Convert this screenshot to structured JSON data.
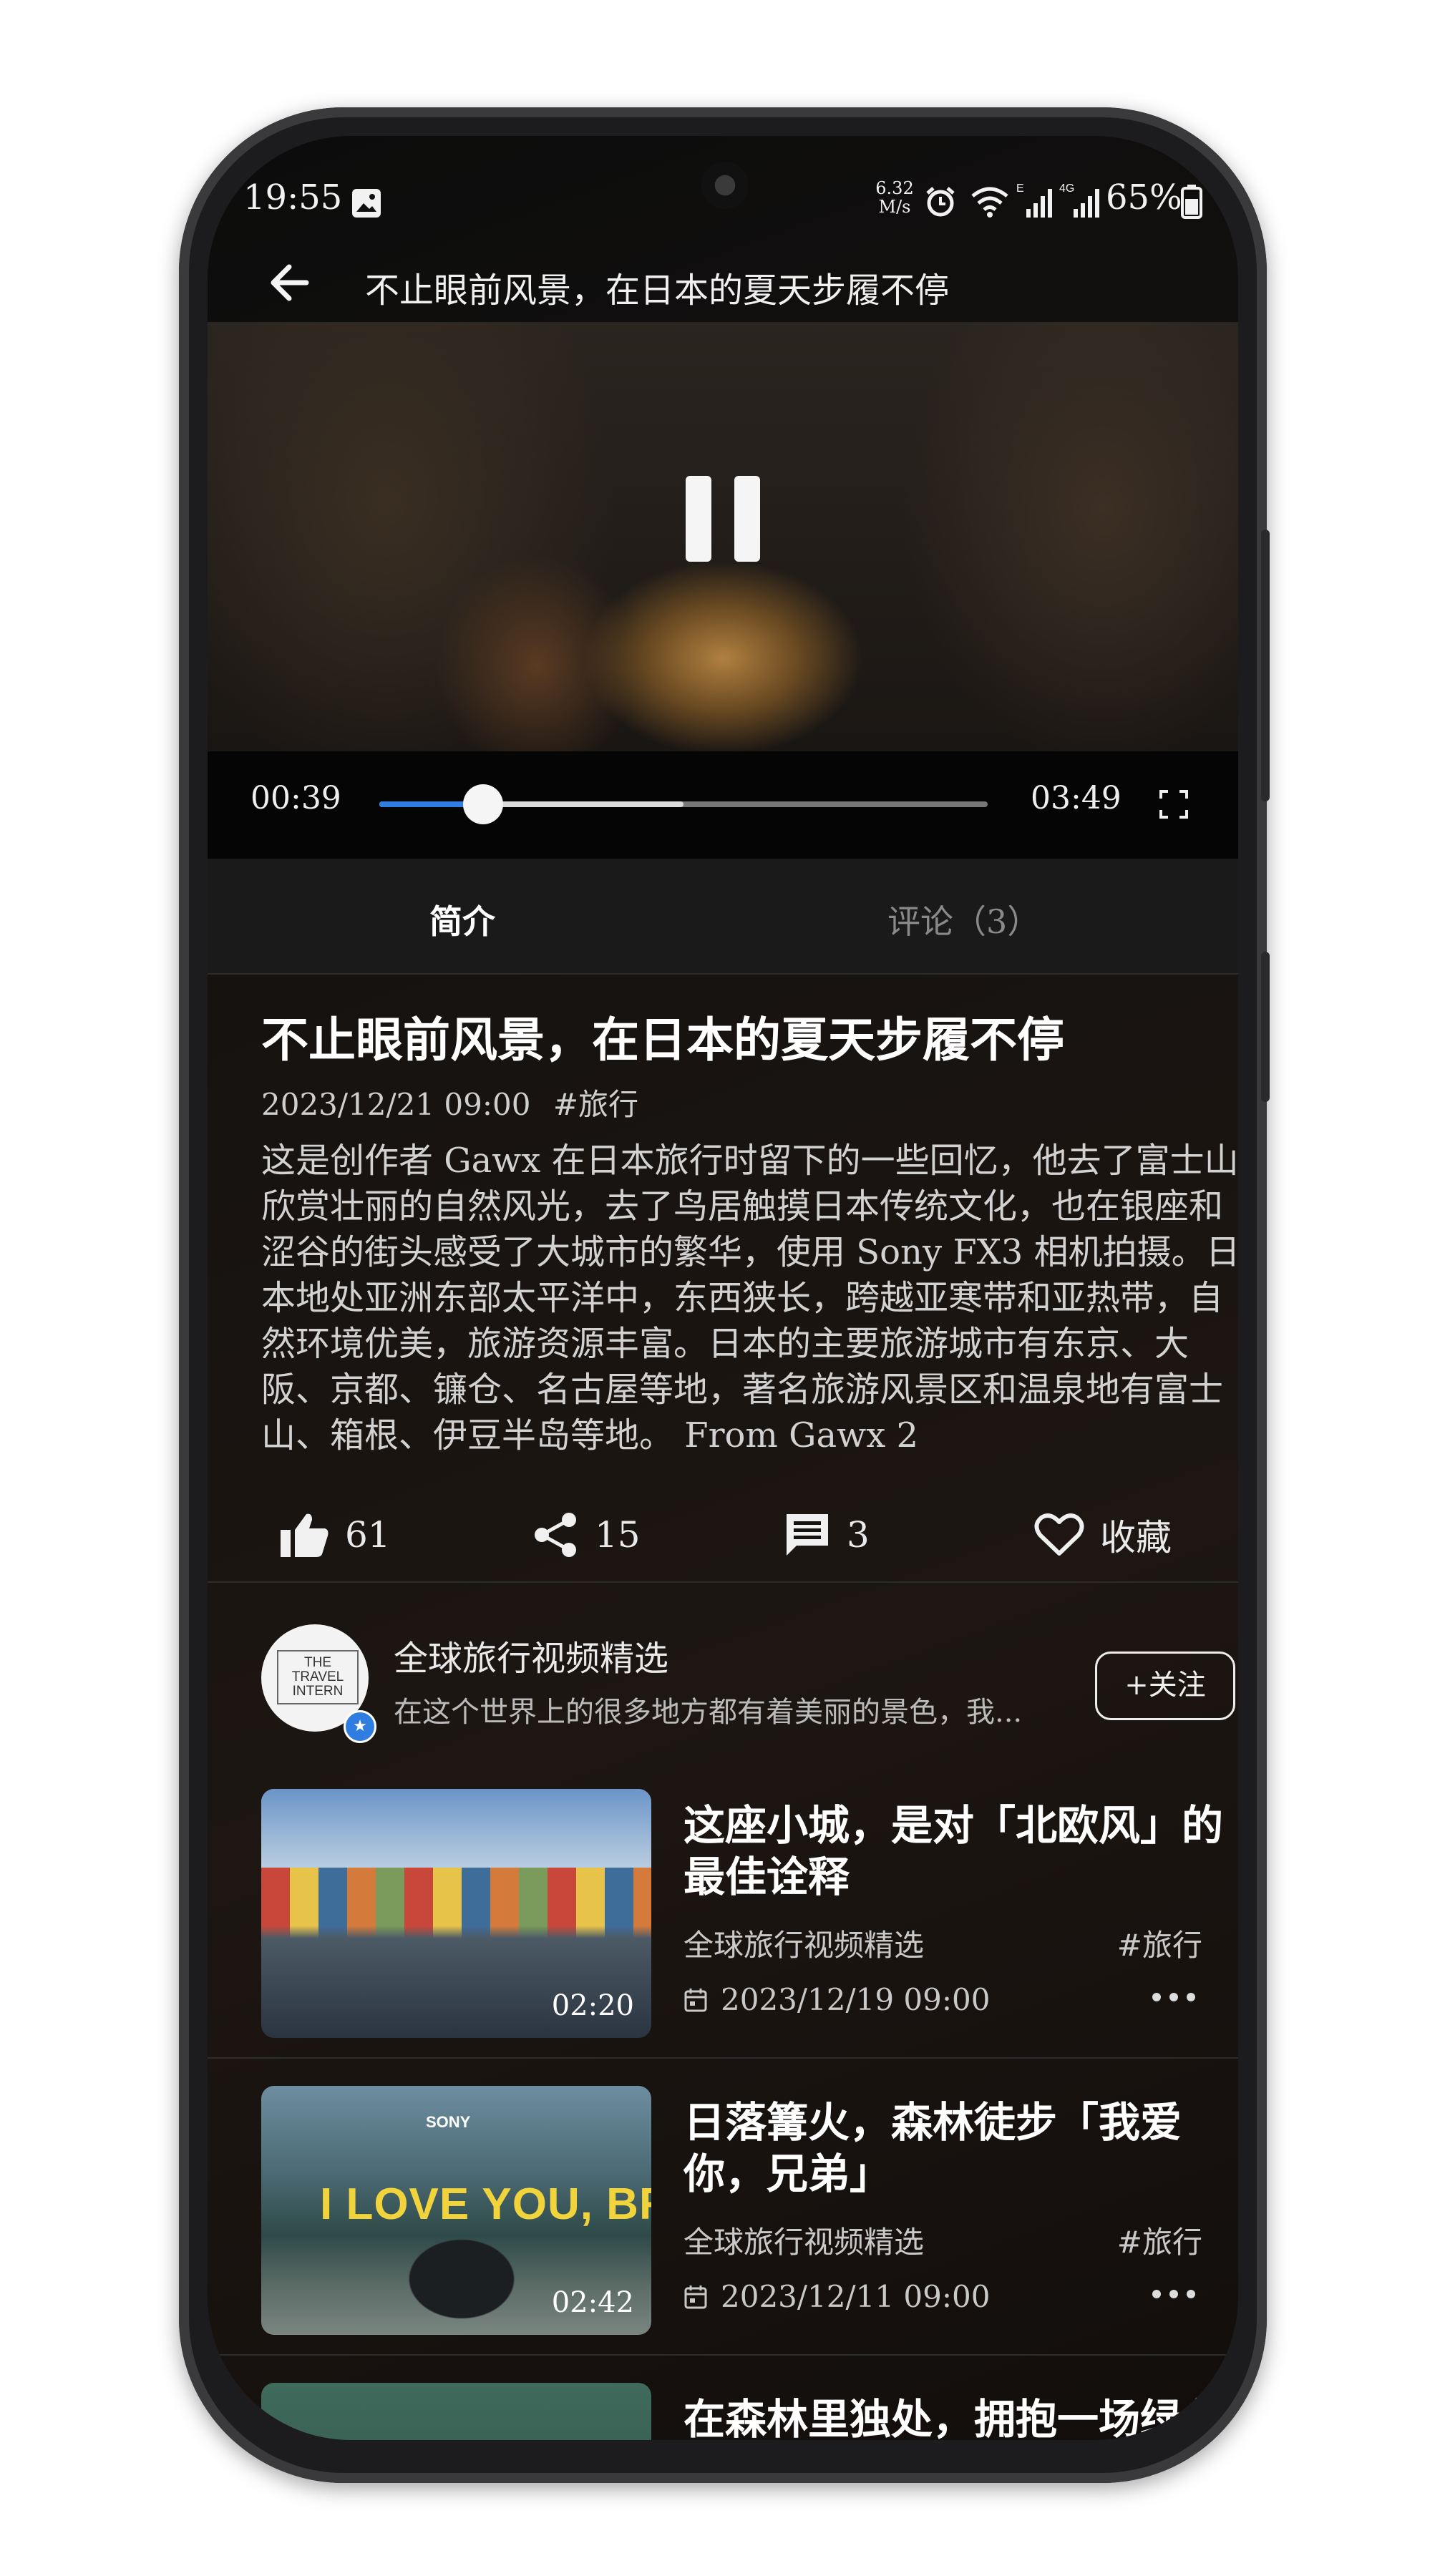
{
  "status_bar": {
    "time": "19:55",
    "net_speed": "6.32 M/s",
    "battery": "65%"
  },
  "header": {
    "title": "不止眼前风景，在日本的夏天步履不停"
  },
  "player": {
    "current_time": "00:39",
    "total_time": "03:49",
    "progress_fraction": 0.17,
    "buffered_fraction": 0.5
  },
  "tabs": [
    {
      "label": "简介",
      "active": true
    },
    {
      "label": "评论（3）",
      "active": false
    }
  ],
  "intro": {
    "title": "不止眼前风景，在日本的夏天步履不停",
    "date": "2023/12/21 09:00",
    "tag": "#旅行",
    "description": "这是创作者 Gawx 在日本旅行时留下的一些回忆，他去了富士山欣赏壮丽的自然风光，去了鸟居触摸日本传统文化，也在银座和涩谷的街头感受了大城市的繁华，使用 Sony FX3 相机拍摄。日本地处亚洲东部太平洋中，东西狭长，跨越亚寒带和亚热带，自然环境优美，旅游资源丰富。日本的主要旅游城市有东京、大阪、京都、镰仓、名古屋等地，著名旅游风景区和温泉地有富士山、箱根、伊豆半岛等地。 From Gawx 2"
  },
  "actions": {
    "likes": "61",
    "shares": "15",
    "comments": "3",
    "favorite_label": "收藏"
  },
  "channel": {
    "name": "全球旅行视频精选",
    "description": "在这个世界上的很多地方都有着美丽的景色，我...",
    "avatar_text": "THE TRAVEL INTERN",
    "follow_label": "+关注"
  },
  "related": [
    {
      "title": "这座小城，是对「北欧风」的最佳诠释",
      "author": "全球旅行视频精选",
      "tag": "#旅行",
      "date": "2023/12/19 09:00",
      "duration": "02:20"
    },
    {
      "title": "日落篝火，森林徒步「我爱你，兄弟」",
      "author": "全球旅行视频精选",
      "tag": "#旅行",
      "date": "2023/12/11 09:00",
      "duration": "02:42",
      "thumb_text": "I LOVE YOU, BRO",
      "thumb_brand": "SONY"
    },
    {
      "title": "在森林里独处，拥抱一场绿色"
    }
  ],
  "colors": {
    "accent": "#2f7de1",
    "background": "#151210"
  }
}
